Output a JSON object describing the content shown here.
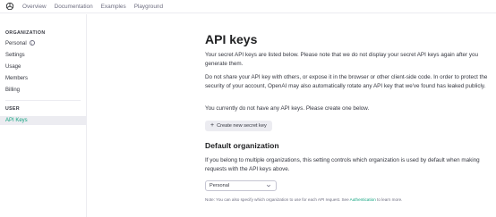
{
  "topnav": {
    "items": [
      "Overview",
      "Documentation",
      "Examples",
      "Playground"
    ]
  },
  "sidebar": {
    "org_title": "ORGANIZATION",
    "org_items": [
      {
        "label": "Personal",
        "icon": "info-icon"
      },
      {
        "label": "Settings"
      },
      {
        "label": "Usage"
      },
      {
        "label": "Members"
      },
      {
        "label": "Billing"
      }
    ],
    "user_title": "USER",
    "user_items": [
      {
        "label": "API Keys",
        "active": true
      }
    ]
  },
  "main": {
    "title": "API keys",
    "intro": "Your secret API keys are listed below. Please note that we do not display your secret API keys again after you generate them.",
    "warning": "Do not share your API key with others, or expose it in the browser or other client-side code. In order to protect the security of your account, OpenAI may also automatically rotate any API key that we've found has leaked publicly.",
    "empty_state": "You currently do not have any API keys. Please create one below.",
    "create_button": "Create new secret key",
    "default_org_title": "Default organization",
    "default_org_desc": "If you belong to multiple organizations, this setting controls which organization is used by default when making requests with the API keys above.",
    "org_select_value": "Personal",
    "note_prefix": "Note: You can also specify which organization to use for each API request. See ",
    "note_link": "Authentication",
    "note_suffix": " to learn more."
  },
  "colors": {
    "accent": "#10a37f",
    "text": "#353740",
    "muted": "#6e6e80",
    "border": "#ececf1"
  }
}
